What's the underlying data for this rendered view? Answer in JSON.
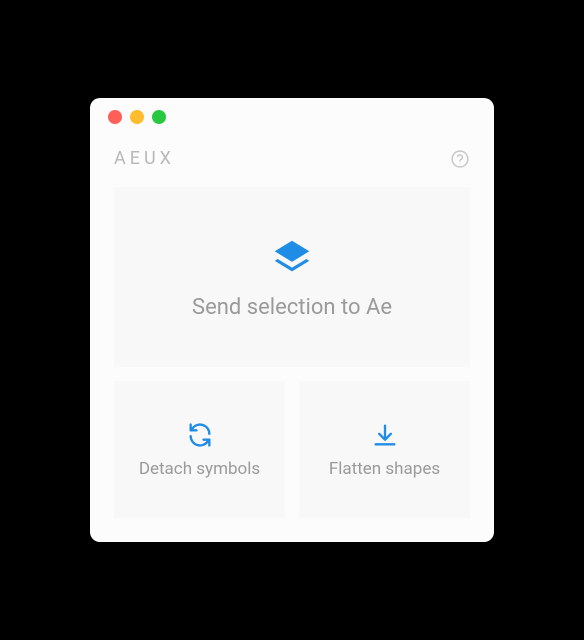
{
  "header": {
    "title": "AEUX"
  },
  "actions": {
    "send": "Send selection to Ae",
    "detach": "Detach symbols",
    "flatten": "Flatten shapes"
  },
  "colors": {
    "accent": "#1f8ce6",
    "text_muted": "#9a9a9a",
    "card_bg": "#f8f8f8"
  }
}
